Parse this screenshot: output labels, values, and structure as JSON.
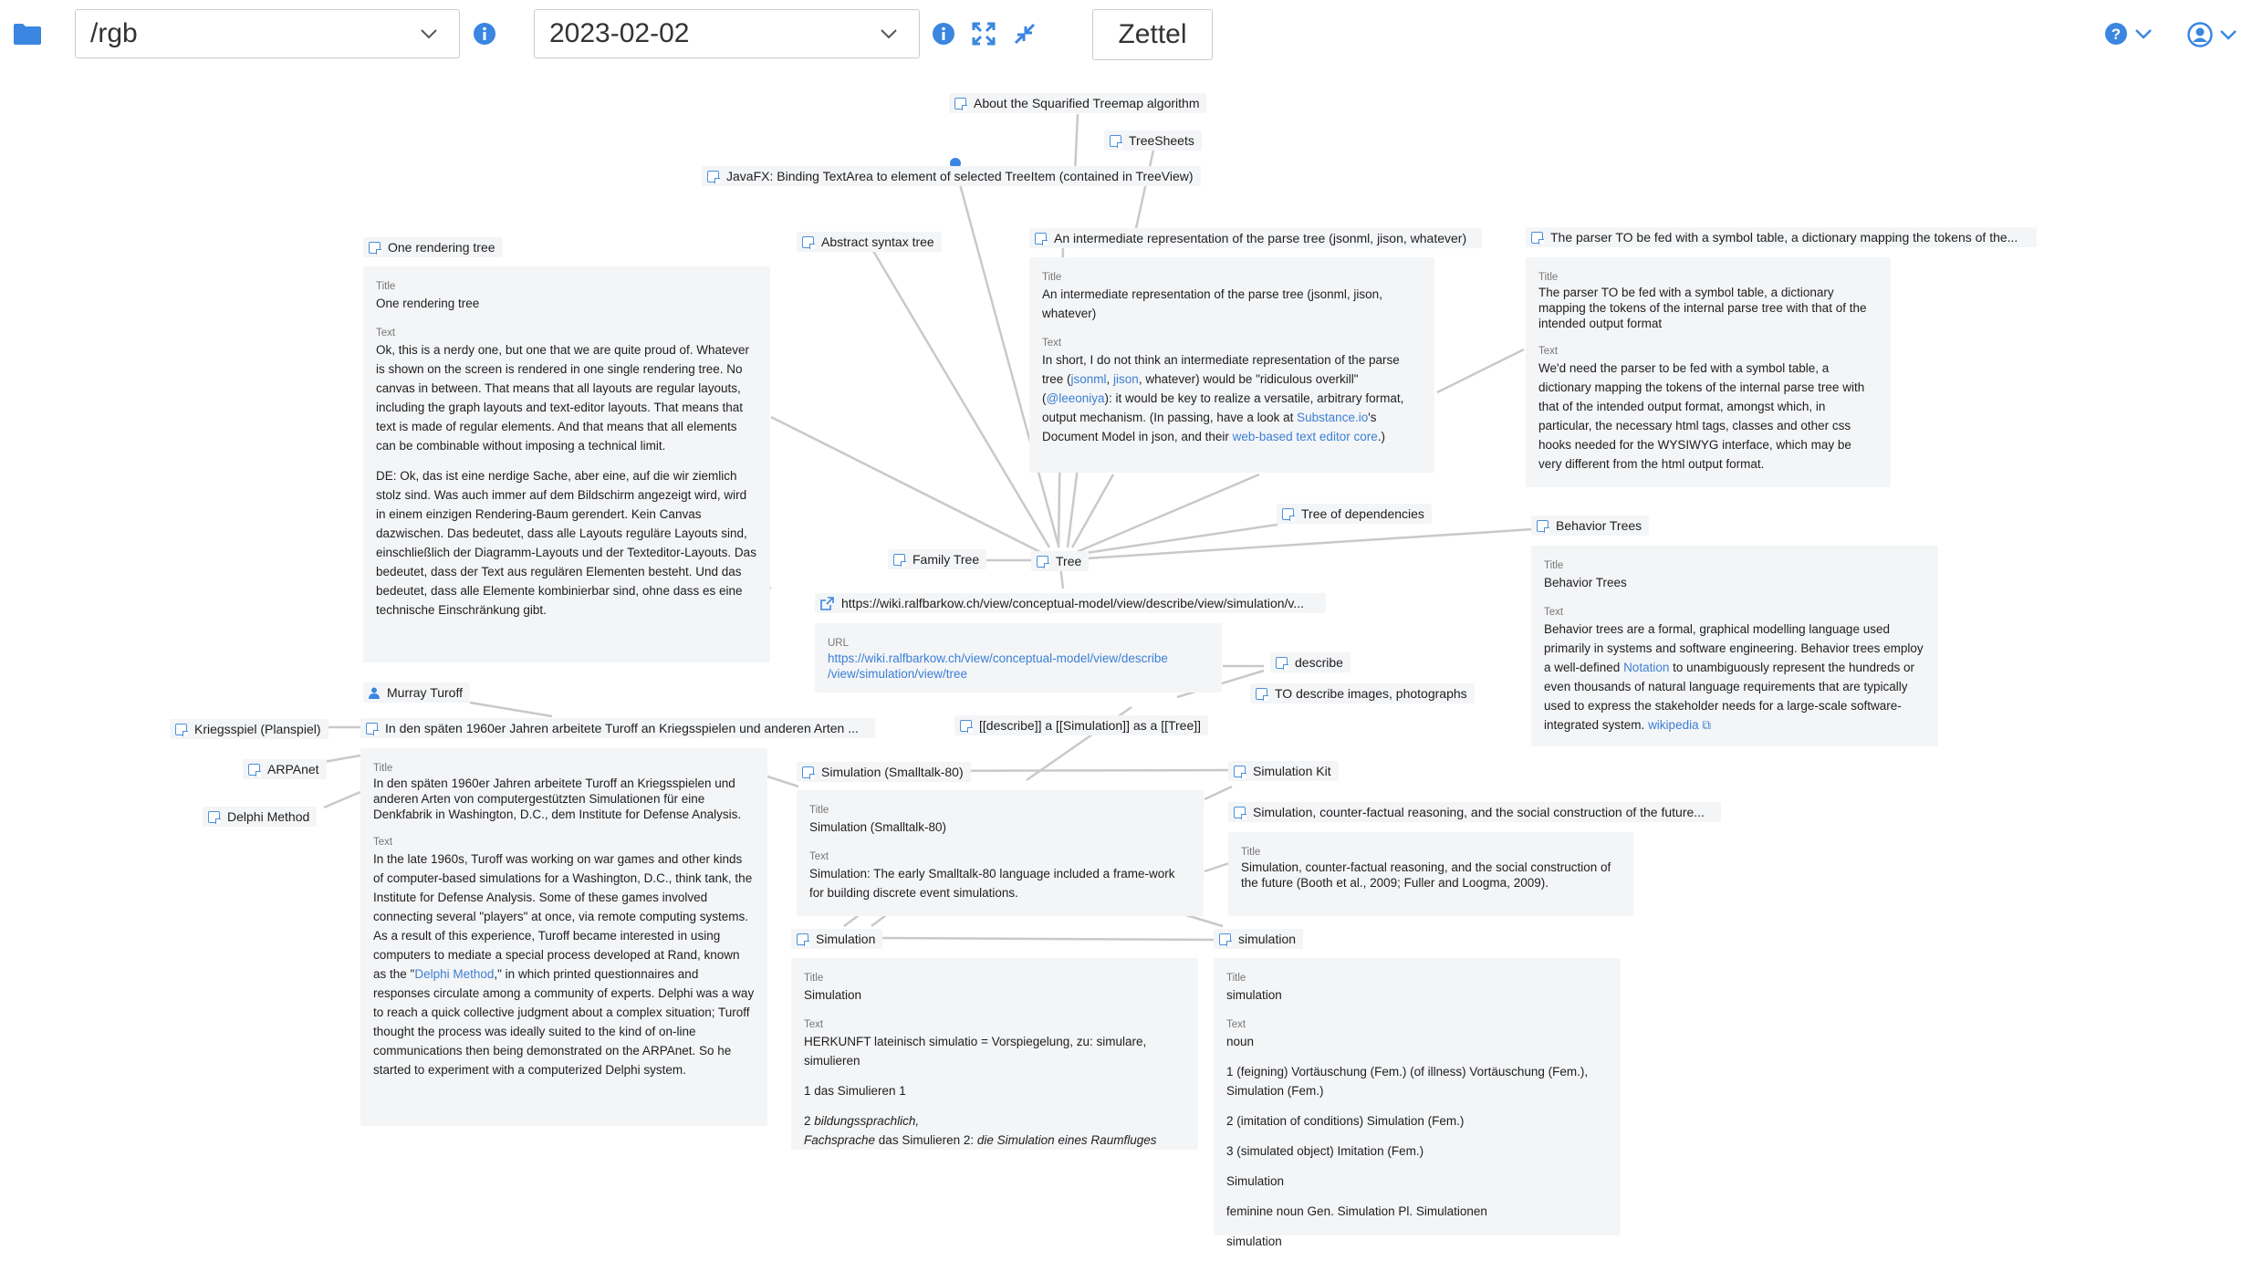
{
  "toolbar": {
    "path_value": "/rgb",
    "date_value": "2023-02-02",
    "zettel_label": "Zettel"
  },
  "colors": {
    "accent": "#3a86e0",
    "card_bg": "#f4f5f7",
    "edge": "#c8c8c8"
  },
  "nodes": {
    "squarified": "About the Squarified Treemap algorithm",
    "treesheets": "TreeSheets",
    "javafx": "JavaFX: Binding TextArea to element of selected TreeItem (contained in TreeView)",
    "abstract_syntax": "Abstract syntax tree",
    "intermediate": "An intermediate representation of the parse tree (jsonml, jison, whatever)",
    "parser": "The parser TO be fed with a symbol table, a dictionary mapping the tokens of the...",
    "one_rendering": "One rendering tree",
    "tree_deps": "Tree of dependencies",
    "behavior": "Behavior Trees",
    "family_tree": "Family Tree",
    "tree": "Tree",
    "wiki_url": "https://wiki.ralfbarkow.ch/view/conceptual-model/view/describe/view/simulation/v...",
    "describe": "describe",
    "to_describe": "TO describe images, photographs",
    "describe_sim": "[[describe]] a [[Simulation]] as a [[Tree]]",
    "murray": "Murray Turoff",
    "kriegsspiel": "Kriegsspiel (Planspiel)",
    "in_den_spaeten": "In den späten 1960er Jahren arbeitete Turoff an Kriegsspielen und anderen Arten ...",
    "arpanet": "ARPAnet",
    "delphi": "Delphi Method",
    "sim_smalltalk": "Simulation (Smalltalk-80)",
    "sim_kit": "Simulation Kit",
    "sim_counterfactual": "Simulation, counter-factual reasoning, and the social construction of the future...",
    "simulation_cap": "Simulation",
    "simulation_low": "simulation"
  },
  "cards": {
    "title_label": "Title",
    "text_label": "Text",
    "url_label": "URL",
    "intermediate": {
      "title": "An intermediate representation of the parse tree (jsonml, jison, whatever)",
      "t1": "In short, I do not think an intermediate representation of the parse tree (",
      "l1": "jsonml",
      "t2": ", ",
      "l2": "jison",
      "t3": ", whatever) would be \"ridiculous overkill\" (",
      "l3": "@leeoniya",
      "t4": "): it would be key to realize a versatile, arbitrary format, output mechanism. (In passing, have a look at ",
      "l4": "Substance.io",
      "t5": "'s Document Model in json, and their ",
      "l5": "web-based text editor core",
      "t6": ".)"
    },
    "parser": {
      "title": "The parser TO be fed with a symbol table, a dictionary mapping the tokens of the internal parse tree with that of the intended output format",
      "text": "We'd need the parser to be fed with a symbol table, a dictionary mapping the tokens of the internal parse tree with that of the intended output format, amongst which, in particular, the necessary html tags, classes and other css hooks needed for the WYSIWYG interface, which may be very different from the html output format."
    },
    "one_rendering": {
      "title": "One rendering tree",
      "text1": "Ok, this is a nerdy one, but one that we are quite proud of. Whatever is shown on the screen is rendered in one single rendering tree. No canvas in between. That means that all layouts are regular layouts, including the graph layouts and text-editor layouts. That means that text is made of regular elements. And that means that all elements can be combinable without imposing a technical limit.",
      "text2": "DE: Ok, das ist eine nerdige Sache, aber eine, auf die wir ziemlich stolz sind. Was auch immer auf dem Bildschirm angezeigt wird, wird in einem einzigen Rendering-Baum gerendert. Kein Canvas dazwischen. Das bedeutet, dass alle Layouts reguläre Layouts sind, einschließlich der Diagramm-Layouts und der Texteditor-Layouts. Das bedeutet, dass der Text aus regulären Elementen besteht. Und das bedeutet, dass alle Elemente kombinierbar sind, ohne dass es eine technische Einschränkung gibt."
    },
    "behavior": {
      "title": "Behavior Trees",
      "t1": "Behavior trees are a formal, graphical modelling language used primarily in systems and software engineering. Behavior trees employ a well-defined ",
      "l1": "Notation",
      "t2": " to unambiguously represent the hundreds or even thousands of natural language requirements that are typically used to express the stakeholder needs for a large-scale software-integrated system. ",
      "l2": "wikipedia"
    },
    "wiki": {
      "url": "https://wiki.ralfbarkow.ch/view/conceptual-model/view/describe /view/simulation/view/tree"
    },
    "in_den_spaeten": {
      "title": "In den späten 1960er Jahren arbeitete Turoff an Kriegsspielen und anderen Arten von computergestützten Simulationen für eine Denkfabrik in Washington, D.C., dem Institute for Defense Analysis.",
      "t1": "In the late 1960s, Turoff was working on war games and other kinds of computer-based simulations for a Washington, D.C., think tank, the Institute for Defense Analysis. Some of these games involved connecting several \"players\" at once, via remote computing systems. As a result of this experience, Turoff became interested in using computers to mediate a special process developed at Rand, known as the \"",
      "l1": "Delphi Method",
      "t2": ",\" in which printed questionnaires and responses circulate among a community of experts. Delphi was a way to reach a quick collective judgment about a complex situation; Turoff thought the process was ideally suited to the kind of on-line communications then being demonstrated on the ARPAnet. So he started to experiment with a computerized Delphi system."
    },
    "sim_smalltalk": {
      "title": "Simulation (Smalltalk-80)",
      "text": "Simulation: The early Smalltalk-80 language included a frame-work for building discrete event simulations."
    },
    "sim_counterfactual": {
      "title": "Simulation, counter-factual reasoning, and the social construction of the future (Booth et al., 2009; Fuller and Loogma, 2009)."
    },
    "simulation_cap": {
      "title": "Simulation",
      "p1": "HERKUNFT lateinisch simulatio  = Vorspiegelung, zu: simulare, simulieren",
      "p2": "1 das Simulieren 1",
      "p3a": "2 ",
      "p3b": "bildungssprachlich,",
      "p3c": "Fachsprache",
      "p3d": " das Simulieren 2: ",
      "p3e": "die Simulation eines Raumfluges"
    },
    "simulation_low": {
      "title": "simulation",
      "p1": "noun",
      "p2": "1 (feigning) Vortäuschung (Fem.) (of illness) Vortäuschung (Fem.), Simulation (Fem.)",
      "p3": "2 (imitation of conditions) Simulation (Fem.)",
      "p4": "3 (simulated object) Imitation (Fem.)",
      "p5": "Simulation",
      "p6": "feminine noun Gen. Simulation Pl. Simulationen",
      "p7": "simulation"
    }
  }
}
